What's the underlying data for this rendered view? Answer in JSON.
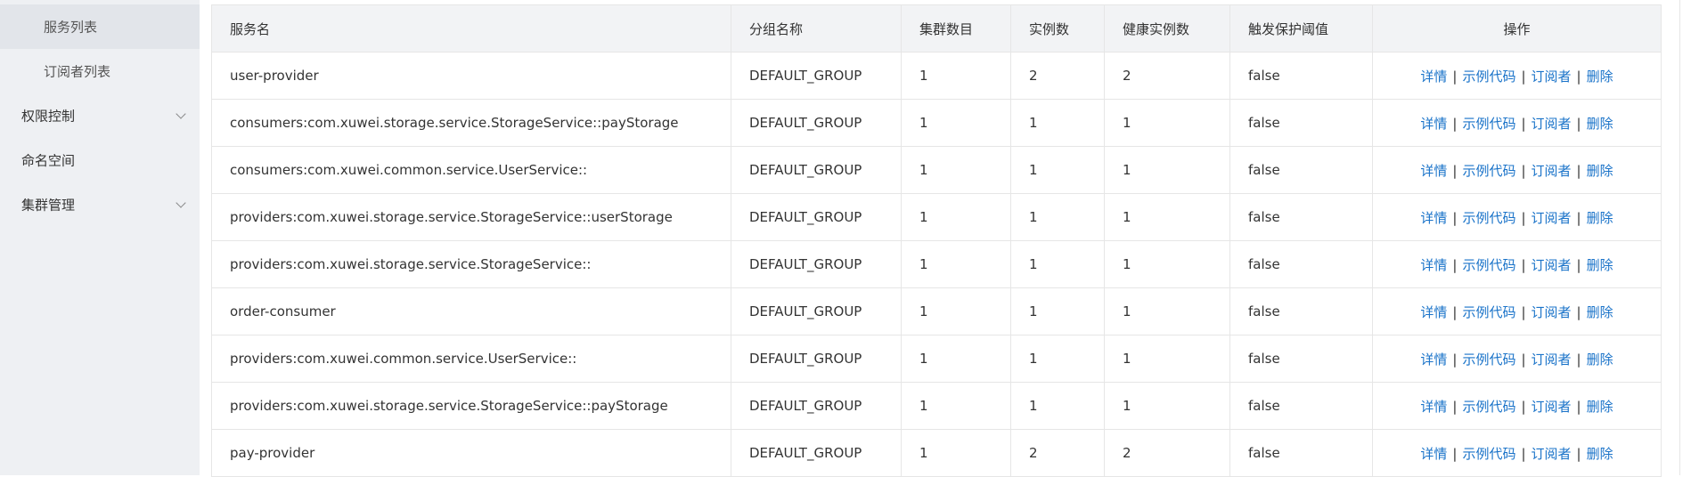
{
  "sidebar": {
    "items": [
      {
        "label": "服务列表",
        "level": "sub",
        "active": true
      },
      {
        "label": "订阅者列表",
        "level": "sub",
        "active": false
      },
      {
        "label": "权限控制",
        "level": "top",
        "expandable": true
      },
      {
        "label": "命名空间",
        "level": "top",
        "expandable": false
      },
      {
        "label": "集群管理",
        "level": "top",
        "expandable": true
      }
    ]
  },
  "table": {
    "headers": [
      "服务名",
      "分组名称",
      "集群数目",
      "实例数",
      "健康实例数",
      "触发保护阈值",
      "操作"
    ],
    "actions": [
      "详情",
      "示例代码",
      "订阅者",
      "删除"
    ],
    "rows": [
      [
        "user-provider",
        "DEFAULT_GROUP",
        "1",
        "2",
        "2",
        "false"
      ],
      [
        "consumers:com.xuwei.storage.service.StorageService::payStorage",
        "DEFAULT_GROUP",
        "1",
        "1",
        "1",
        "false"
      ],
      [
        "consumers:com.xuwei.common.service.UserService::",
        "DEFAULT_GROUP",
        "1",
        "1",
        "1",
        "false"
      ],
      [
        "providers:com.xuwei.storage.service.StorageService::userStorage",
        "DEFAULT_GROUP",
        "1",
        "1",
        "1",
        "false"
      ],
      [
        "providers:com.xuwei.storage.service.StorageService::",
        "DEFAULT_GROUP",
        "1",
        "1",
        "1",
        "false"
      ],
      [
        "order-consumer",
        "DEFAULT_GROUP",
        "1",
        "1",
        "1",
        "false"
      ],
      [
        "providers:com.xuwei.common.service.UserService::",
        "DEFAULT_GROUP",
        "1",
        "1",
        "1",
        "false"
      ],
      [
        "providers:com.xuwei.storage.service.StorageService::payStorage",
        "DEFAULT_GROUP",
        "1",
        "1",
        "1",
        "false"
      ],
      [
        "pay-provider",
        "DEFAULT_GROUP",
        "1",
        "2",
        "2",
        "false"
      ]
    ]
  },
  "colors": {
    "sidebar_bg": "#eef0f3",
    "header_bg": "#f2f3f5",
    "link": "#1a73c9",
    "border": "#e6e6e6"
  }
}
